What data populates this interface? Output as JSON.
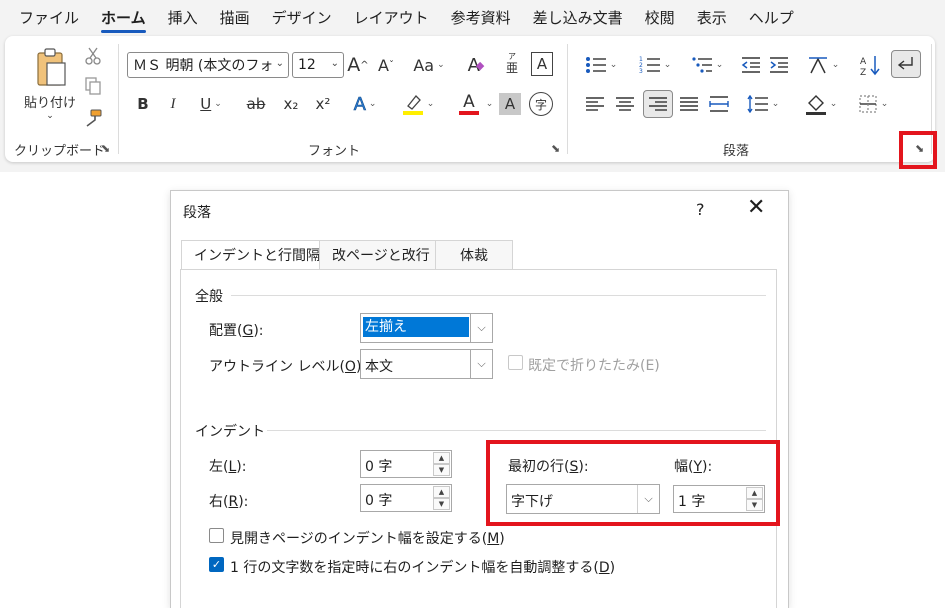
{
  "menu": {
    "tabs": [
      "ファイル",
      "ホーム",
      "挿入",
      "描画",
      "デザイン",
      "レイアウト",
      "参考資料",
      "差し込み文書",
      "校閲",
      "表示",
      "ヘルプ"
    ],
    "active": "ホーム"
  },
  "ribbon": {
    "clipboard": {
      "paste_label": "貼り付け",
      "group_label": "クリップボード"
    },
    "font": {
      "font_name": "ＭＳ 明朝 (本文のフォ",
      "font_size": "12",
      "group_label": "フォント",
      "bold": "B",
      "italic": "I",
      "underline": "U",
      "strike": "ab",
      "subscript": "x₂",
      "superscript": "x²",
      "change_case": "Aa",
      "grow": "A",
      "shrink": "A",
      "font_color_letter": "A",
      "char_shading_letter": "A",
      "phonetic_main": "亜",
      "phonetic_ruby": "ア",
      "enclose_char": "字",
      "border_char": "A",
      "highlight_color": "#ffef00",
      "font_color": "#e3151d"
    },
    "paragraph": {
      "group_label": "段落"
    },
    "accent": "#185abd"
  },
  "dialog": {
    "title": "段落",
    "help": "?",
    "close": "✕",
    "tabs": [
      "インデントと行間隔",
      "改ページと改行",
      "体裁"
    ],
    "general": {
      "section": "全般",
      "alignment_label": "配置(",
      "alignment_key": "G",
      "alignment_suffix": "):",
      "alignment_value": "左揃え",
      "outline_label": "アウトライン レベル(",
      "outline_key": "O",
      "outline_suffix": "):",
      "outline_value": "本文",
      "collapsed_label": "既定で折りたたみ(E)"
    },
    "indent": {
      "section": "インデント",
      "left_label": "左(",
      "left_key": "L",
      "left_suffix": "):",
      "left_value": "0 字",
      "right_label": "右(",
      "right_key": "R",
      "right_suffix": "):",
      "right_value": "0 字",
      "first_line_label": "最初の行(",
      "first_line_key": "S",
      "first_line_suffix": "):",
      "first_line_value": "字下げ",
      "by_label": "幅(",
      "by_key": "Y",
      "by_suffix": "):",
      "by_value": "1 字",
      "mirror_label": "見開きページのインデント幅を設定する(",
      "mirror_key": "M",
      "mirror_suffix": ")",
      "mirror_checked": false,
      "auto_adjust_label": "1 行の文字数を指定時に右のインデント幅を自動調整する(",
      "auto_adjust_key": "D",
      "auto_adjust_suffix": ")",
      "auto_adjust_checked": true
    }
  }
}
